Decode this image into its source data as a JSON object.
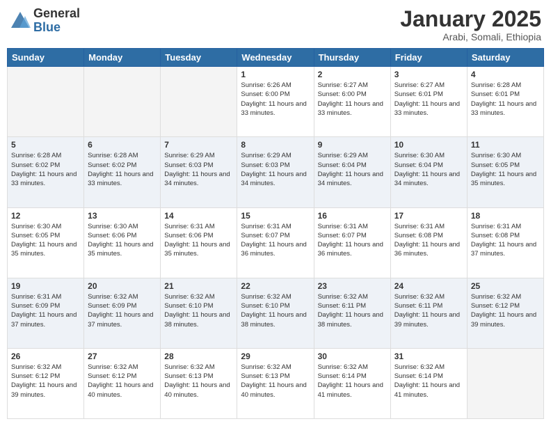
{
  "header": {
    "logo_general": "General",
    "logo_blue": "Blue",
    "month_title": "January 2025",
    "subtitle": "Arabi, Somali, Ethiopia"
  },
  "days_of_week": [
    "Sunday",
    "Monday",
    "Tuesday",
    "Wednesday",
    "Thursday",
    "Friday",
    "Saturday"
  ],
  "weeks": [
    {
      "days": [
        {
          "num": "",
          "info": ""
        },
        {
          "num": "",
          "info": ""
        },
        {
          "num": "",
          "info": ""
        },
        {
          "num": "1",
          "info": "Sunrise: 6:26 AM\nSunset: 6:00 PM\nDaylight: 11 hours\nand 33 minutes."
        },
        {
          "num": "2",
          "info": "Sunrise: 6:27 AM\nSunset: 6:00 PM\nDaylight: 11 hours\nand 33 minutes."
        },
        {
          "num": "3",
          "info": "Sunrise: 6:27 AM\nSunset: 6:01 PM\nDaylight: 11 hours\nand 33 minutes."
        },
        {
          "num": "4",
          "info": "Sunrise: 6:28 AM\nSunset: 6:01 PM\nDaylight: 11 hours\nand 33 minutes."
        }
      ]
    },
    {
      "days": [
        {
          "num": "5",
          "info": "Sunrise: 6:28 AM\nSunset: 6:02 PM\nDaylight: 11 hours\nand 33 minutes."
        },
        {
          "num": "6",
          "info": "Sunrise: 6:28 AM\nSunset: 6:02 PM\nDaylight: 11 hours\nand 33 minutes."
        },
        {
          "num": "7",
          "info": "Sunrise: 6:29 AM\nSunset: 6:03 PM\nDaylight: 11 hours\nand 34 minutes."
        },
        {
          "num": "8",
          "info": "Sunrise: 6:29 AM\nSunset: 6:03 PM\nDaylight: 11 hours\nand 34 minutes."
        },
        {
          "num": "9",
          "info": "Sunrise: 6:29 AM\nSunset: 6:04 PM\nDaylight: 11 hours\nand 34 minutes."
        },
        {
          "num": "10",
          "info": "Sunrise: 6:30 AM\nSunset: 6:04 PM\nDaylight: 11 hours\nand 34 minutes."
        },
        {
          "num": "11",
          "info": "Sunrise: 6:30 AM\nSunset: 6:05 PM\nDaylight: 11 hours\nand 35 minutes."
        }
      ]
    },
    {
      "days": [
        {
          "num": "12",
          "info": "Sunrise: 6:30 AM\nSunset: 6:05 PM\nDaylight: 11 hours\nand 35 minutes."
        },
        {
          "num": "13",
          "info": "Sunrise: 6:30 AM\nSunset: 6:06 PM\nDaylight: 11 hours\nand 35 minutes."
        },
        {
          "num": "14",
          "info": "Sunrise: 6:31 AM\nSunset: 6:06 PM\nDaylight: 11 hours\nand 35 minutes."
        },
        {
          "num": "15",
          "info": "Sunrise: 6:31 AM\nSunset: 6:07 PM\nDaylight: 11 hours\nand 36 minutes."
        },
        {
          "num": "16",
          "info": "Sunrise: 6:31 AM\nSunset: 6:07 PM\nDaylight: 11 hours\nand 36 minutes."
        },
        {
          "num": "17",
          "info": "Sunrise: 6:31 AM\nSunset: 6:08 PM\nDaylight: 11 hours\nand 36 minutes."
        },
        {
          "num": "18",
          "info": "Sunrise: 6:31 AM\nSunset: 6:08 PM\nDaylight: 11 hours\nand 37 minutes."
        }
      ]
    },
    {
      "days": [
        {
          "num": "19",
          "info": "Sunrise: 6:31 AM\nSunset: 6:09 PM\nDaylight: 11 hours\nand 37 minutes."
        },
        {
          "num": "20",
          "info": "Sunrise: 6:32 AM\nSunset: 6:09 PM\nDaylight: 11 hours\nand 37 minutes."
        },
        {
          "num": "21",
          "info": "Sunrise: 6:32 AM\nSunset: 6:10 PM\nDaylight: 11 hours\nand 38 minutes."
        },
        {
          "num": "22",
          "info": "Sunrise: 6:32 AM\nSunset: 6:10 PM\nDaylight: 11 hours\nand 38 minutes."
        },
        {
          "num": "23",
          "info": "Sunrise: 6:32 AM\nSunset: 6:11 PM\nDaylight: 11 hours\nand 38 minutes."
        },
        {
          "num": "24",
          "info": "Sunrise: 6:32 AM\nSunset: 6:11 PM\nDaylight: 11 hours\nand 39 minutes."
        },
        {
          "num": "25",
          "info": "Sunrise: 6:32 AM\nSunset: 6:12 PM\nDaylight: 11 hours\nand 39 minutes."
        }
      ]
    },
    {
      "days": [
        {
          "num": "26",
          "info": "Sunrise: 6:32 AM\nSunset: 6:12 PM\nDaylight: 11 hours\nand 39 minutes."
        },
        {
          "num": "27",
          "info": "Sunrise: 6:32 AM\nSunset: 6:12 PM\nDaylight: 11 hours\nand 40 minutes."
        },
        {
          "num": "28",
          "info": "Sunrise: 6:32 AM\nSunset: 6:13 PM\nDaylight: 11 hours\nand 40 minutes."
        },
        {
          "num": "29",
          "info": "Sunrise: 6:32 AM\nSunset: 6:13 PM\nDaylight: 11 hours\nand 40 minutes."
        },
        {
          "num": "30",
          "info": "Sunrise: 6:32 AM\nSunset: 6:14 PM\nDaylight: 11 hours\nand 41 minutes."
        },
        {
          "num": "31",
          "info": "Sunrise: 6:32 AM\nSunset: 6:14 PM\nDaylight: 11 hours\nand 41 minutes."
        },
        {
          "num": "",
          "info": ""
        }
      ]
    }
  ]
}
